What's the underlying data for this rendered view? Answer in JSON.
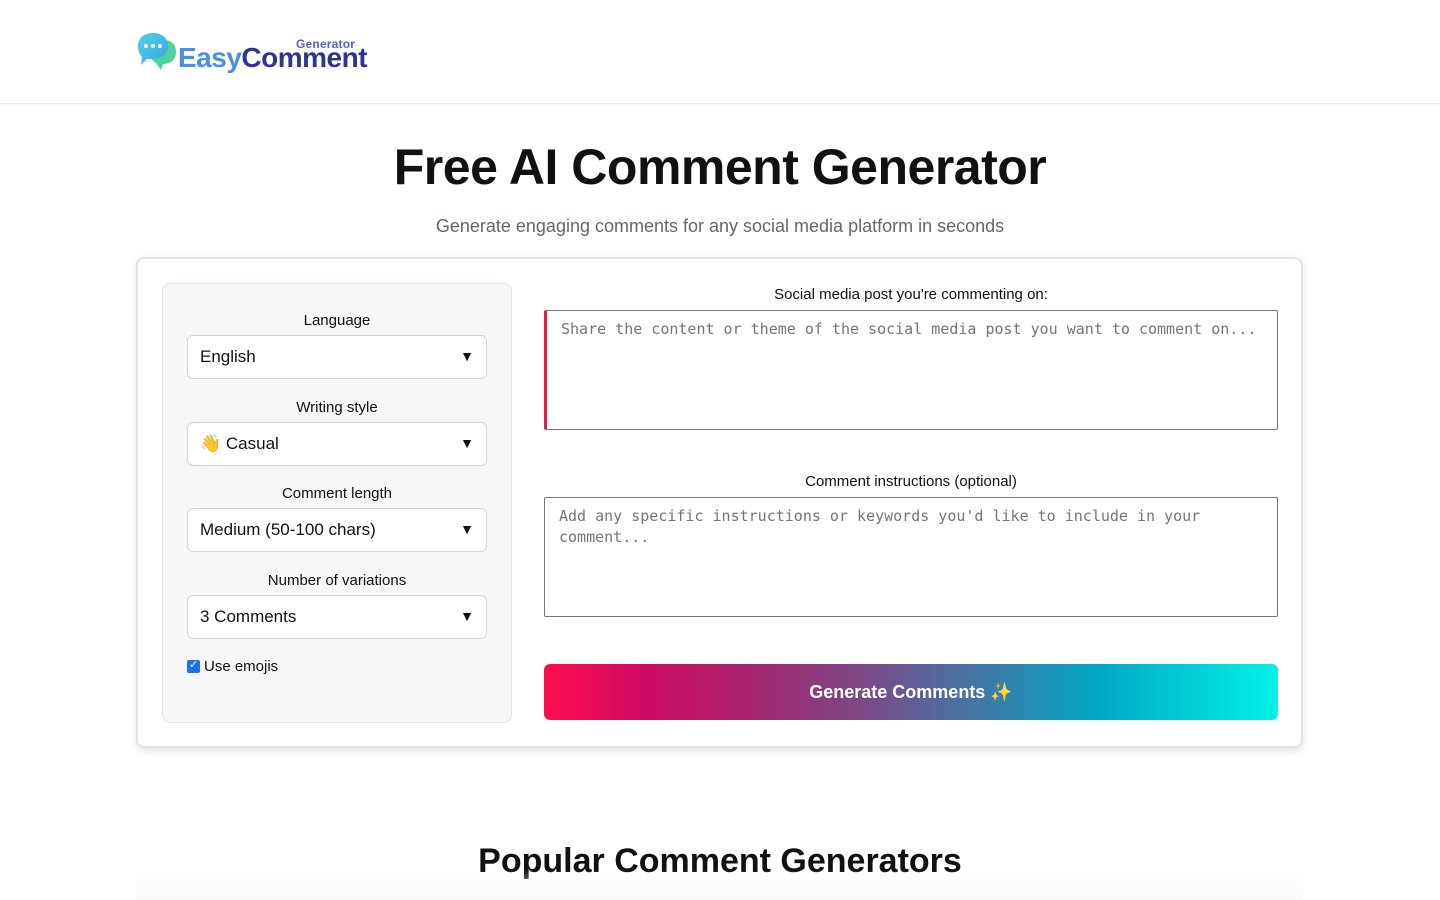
{
  "brand": {
    "name_part1": "Easy",
    "name_part2": "Comment",
    "sub": "Generator",
    "accent_color": "#4a8fe0",
    "dark_color": "#2f3391"
  },
  "hero": {
    "title": "Free AI Comment Generator",
    "subtitle": "Generate engaging comments for any social media platform in seconds"
  },
  "settings": {
    "language": {
      "label": "Language",
      "value": "English"
    },
    "style": {
      "label": "Writing style",
      "value": "👋 Casual"
    },
    "length": {
      "label": "Comment length",
      "value": "Medium (50-100 chars)"
    },
    "variations": {
      "label": "Number of variations",
      "value": "3 Comments"
    },
    "emojis": {
      "label": "Use emojis",
      "checked": true
    }
  },
  "post": {
    "label": "Social media post you're commenting on:",
    "placeholder": "Share the content or theme of the social media post you want to comment on..."
  },
  "instructions": {
    "label": "Comment instructions (optional)",
    "placeholder": "Add any specific instructions or keywords you'd like to include in your comment..."
  },
  "generate_button": {
    "label": "Generate Comments ✨"
  },
  "popular": {
    "title": "Popular Comment Generators"
  }
}
